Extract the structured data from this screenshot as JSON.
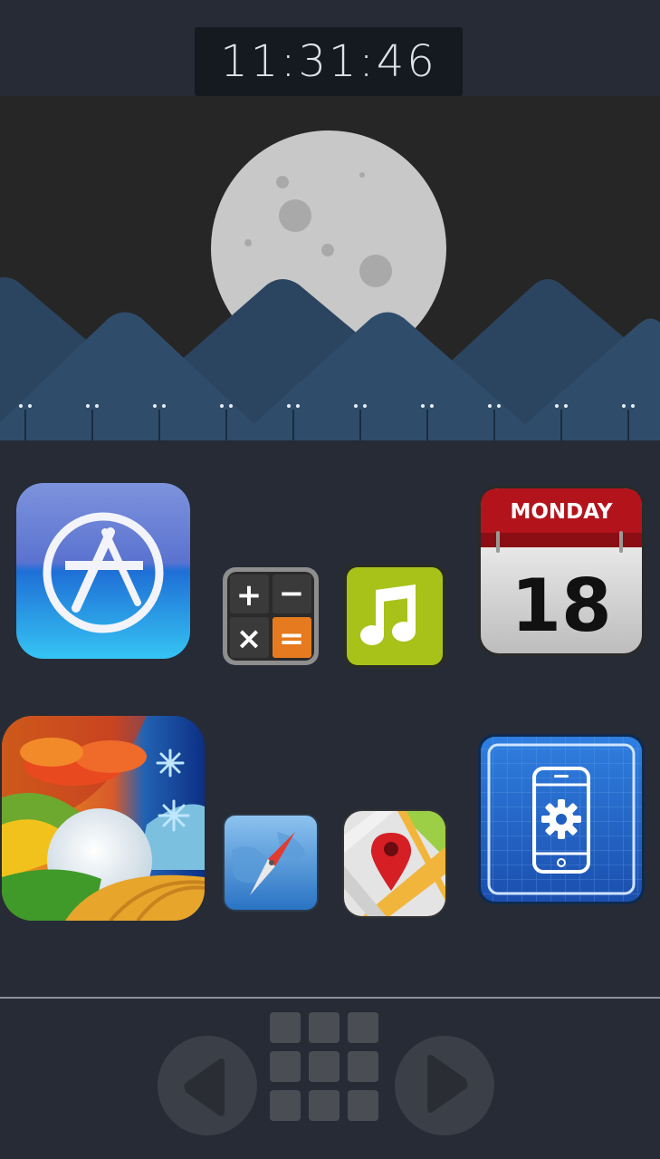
{
  "status": {
    "time": "11:31:46"
  },
  "apps": {
    "app_store": {
      "name": "App Store"
    },
    "calculator": {
      "name": "Calculator",
      "symbols": [
        "+",
        "−",
        "×",
        "="
      ]
    },
    "music": {
      "name": "Music"
    },
    "calendar": {
      "name": "Calendar",
      "day_name": "MONDAY",
      "day_number": "18"
    },
    "weather": {
      "name": "Weather"
    },
    "safari": {
      "name": "Safari"
    },
    "maps": {
      "name": "Maps"
    },
    "settings": {
      "name": "Settings"
    }
  },
  "dock": {
    "prev_icon": "triangle-left-icon",
    "grid_icon": "app-grid-icon",
    "next_icon": "triangle-right-icon"
  },
  "colors": {
    "background": "#262b36",
    "clock_bg": "#151920",
    "mountain": "#2b4561",
    "moon": "#c8c8c8",
    "calendar_red": "#b3141c",
    "music_green": "#a8c21a"
  }
}
